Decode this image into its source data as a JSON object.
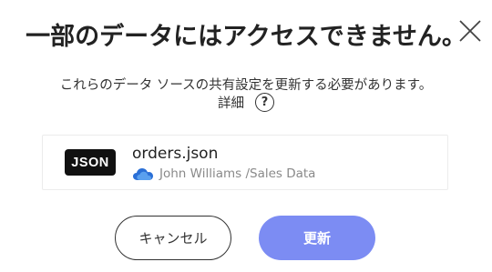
{
  "dialog": {
    "title": "一部のデータにはアクセスできません。",
    "description": "これらのデータ ソースの共有設定を更新する必要があります。",
    "details_label": "詳細",
    "help_icon_glyph": "?",
    "close_icon": "close-icon"
  },
  "source": {
    "badge_label": "JSON",
    "file_name": "orders.json",
    "path": "John Williams /Sales Data",
    "cloud_icon": "onedrive-cloud-icon"
  },
  "buttons": {
    "cancel_label": "キャンセル",
    "update_label": "更新"
  },
  "colors": {
    "primary_button": "#7c8cf3",
    "badge_background": "#111111",
    "cloud_blue": "#2a6fd6"
  }
}
